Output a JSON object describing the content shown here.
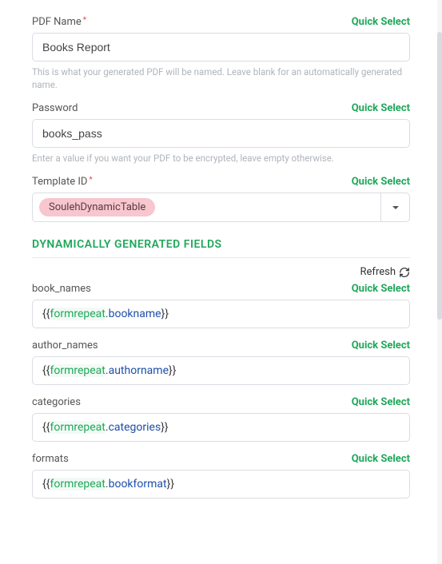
{
  "quick_select_label": "Quick Select",
  "pdf_name": {
    "label": "PDF Name",
    "required": true,
    "value": "Books Report",
    "help": "This is what your generated PDF will be named. Leave blank for an automatically generated name."
  },
  "password": {
    "label": "Password",
    "required": false,
    "value": "books_pass",
    "help": "Enter a value if you want your PDF to be encrypted, leave empty otherwise."
  },
  "template_id": {
    "label": "Template ID",
    "required": true,
    "selected": "SoulehDynamicTable"
  },
  "dynamic_section_title": "DYNAMICALLY GENERATED FIELDS",
  "refresh_label": "Refresh",
  "dynamic_fields": [
    {
      "label": "book_names",
      "scope": "formrepeat",
      "prop": "bookname"
    },
    {
      "label": "author_names",
      "scope": "formrepeat",
      "prop": "authorname"
    },
    {
      "label": "categories",
      "scope": "formrepeat",
      "prop": "categories"
    },
    {
      "label": "formats",
      "scope": "formrepeat",
      "prop": "bookformat"
    }
  ]
}
